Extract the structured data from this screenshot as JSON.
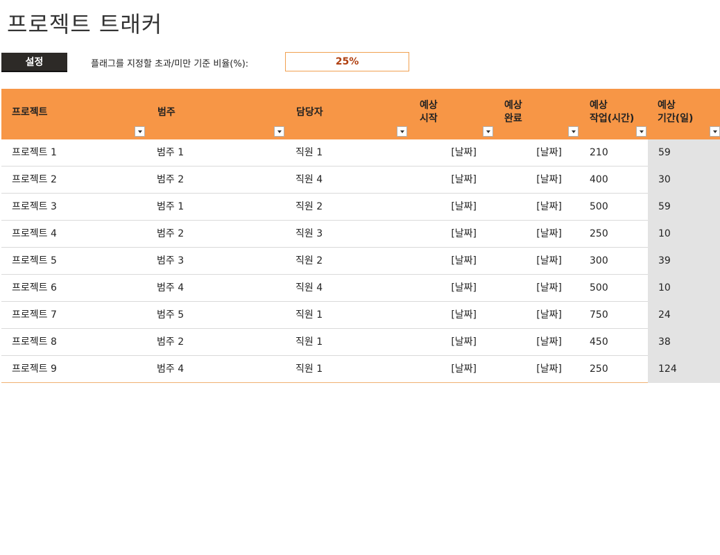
{
  "title": "프로젝트 트래커",
  "settings_button": "설정",
  "flag_label": "플래그를 지정할 초과/미만 기준 비율(%):",
  "flag_value": "25%",
  "headers": {
    "project": "프로젝트",
    "category": "범주",
    "owner": "담당자",
    "start": "예상\n시작",
    "end": "예상\n완료",
    "work": "예상\n작업(시간)",
    "duration": "예상\n기간(일)"
  },
  "rows": [
    {
      "project": "프로젝트 1",
      "category": "범주 1",
      "owner": "직원 1",
      "start": "[날짜]",
      "end": "[날짜]",
      "work": "210",
      "duration": "59"
    },
    {
      "project": "프로젝트 2",
      "category": "범주 2",
      "owner": "직원 4",
      "start": "[날짜]",
      "end": "[날짜]",
      "work": "400",
      "duration": "30"
    },
    {
      "project": "프로젝트 3",
      "category": "범주 1",
      "owner": "직원 2",
      "start": "[날짜]",
      "end": "[날짜]",
      "work": "500",
      "duration": "59"
    },
    {
      "project": "프로젝트 4",
      "category": "범주 2",
      "owner": "직원 3",
      "start": "[날짜]",
      "end": "[날짜]",
      "work": "250",
      "duration": "10"
    },
    {
      "project": "프로젝트 5",
      "category": "범주 3",
      "owner": "직원 2",
      "start": "[날짜]",
      "end": "[날짜]",
      "work": "300",
      "duration": "39"
    },
    {
      "project": "프로젝트 6",
      "category": "범주 4",
      "owner": "직원 4",
      "start": "[날짜]",
      "end": "[날짜]",
      "work": "500",
      "duration": "10"
    },
    {
      "project": "프로젝트 7",
      "category": "범주 5",
      "owner": "직원 1",
      "start": "[날짜]",
      "end": "[날짜]",
      "work": "750",
      "duration": "24"
    },
    {
      "project": "프로젝트 8",
      "category": "범주 2",
      "owner": "직원 1",
      "start": "[날짜]",
      "end": "[날짜]",
      "work": "450",
      "duration": "38"
    },
    {
      "project": "프로젝트 9",
      "category": "범주 4",
      "owner": "직원 1",
      "start": "[날짜]",
      "end": "[날짜]",
      "work": "250",
      "duration": "124"
    }
  ]
}
